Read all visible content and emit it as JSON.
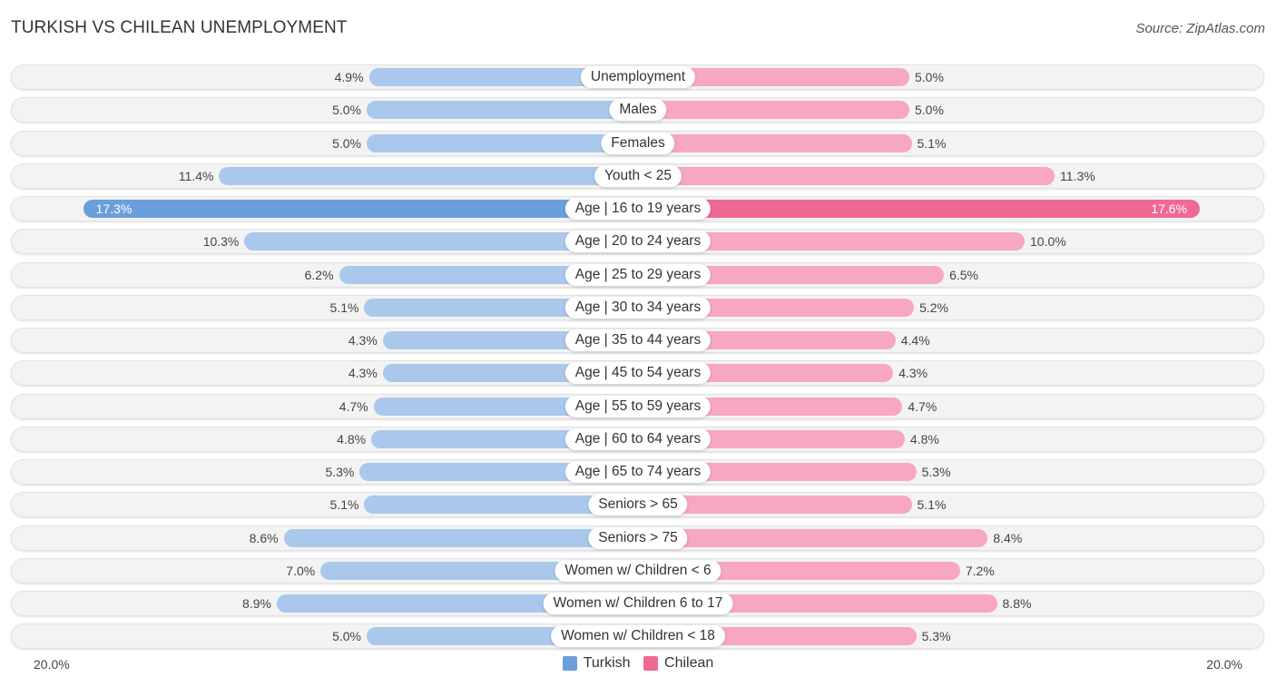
{
  "header": {
    "title": "TURKISH VS CHILEAN UNEMPLOYMENT",
    "source": "Source: ZipAtlas.com"
  },
  "colors": {
    "turkish_strong": "#6a9fdc",
    "turkish_light": "#a9c8eb",
    "chilean_strong": "#f06992",
    "chilean_light": "#f7a7c0"
  },
  "chart_data": {
    "type": "bar",
    "orientation": "horizontal-diverging",
    "title": "TURKISH VS CHILEAN UNEMPLOYMENT",
    "xlabel": "",
    "ylabel": "",
    "axis_min_label": "20.0%",
    "axis_max_label": "20.0%",
    "xlim": [
      0,
      20
    ],
    "legend_position": "bottom-center",
    "categories": [
      "Unemployment",
      "Males",
      "Females",
      "Youth < 25",
      "Age | 16 to 19 years",
      "Age | 20 to 24 years",
      "Age | 25 to 29 years",
      "Age | 30 to 34 years",
      "Age | 35 to 44 years",
      "Age | 45 to 54 years",
      "Age | 55 to 59 years",
      "Age | 60 to 64 years",
      "Age | 65 to 74 years",
      "Seniors > 65",
      "Seniors > 75",
      "Women w/ Children < 6",
      "Women w/ Children 6 to 17",
      "Women w/ Children < 18"
    ],
    "series": [
      {
        "name": "Turkish",
        "side": "left",
        "values": [
          4.9,
          5.0,
          5.0,
          11.4,
          17.3,
          10.3,
          6.2,
          5.1,
          4.3,
          4.3,
          4.7,
          4.8,
          5.3,
          5.1,
          8.6,
          7.0,
          8.9,
          5.0
        ],
        "labels": [
          "4.9%",
          "5.0%",
          "5.0%",
          "11.4%",
          "17.3%",
          "10.3%",
          "6.2%",
          "5.1%",
          "4.3%",
          "4.3%",
          "4.7%",
          "4.8%",
          "5.3%",
          "5.1%",
          "8.6%",
          "7.0%",
          "8.9%",
          "5.0%"
        ]
      },
      {
        "name": "Chilean",
        "side": "right",
        "values": [
          5.0,
          5.0,
          5.1,
          11.3,
          17.6,
          10.0,
          6.5,
          5.2,
          4.4,
          4.3,
          4.7,
          4.8,
          5.3,
          5.1,
          8.4,
          7.2,
          8.8,
          5.3
        ],
        "labels": [
          "5.0%",
          "5.0%",
          "5.1%",
          "11.3%",
          "17.6%",
          "10.0%",
          "6.5%",
          "5.2%",
          "4.4%",
          "4.3%",
          "4.7%",
          "4.8%",
          "5.3%",
          "5.1%",
          "8.4%",
          "7.2%",
          "8.8%",
          "5.3%"
        ]
      }
    ],
    "legend": [
      "Turkish",
      "Chilean"
    ]
  }
}
